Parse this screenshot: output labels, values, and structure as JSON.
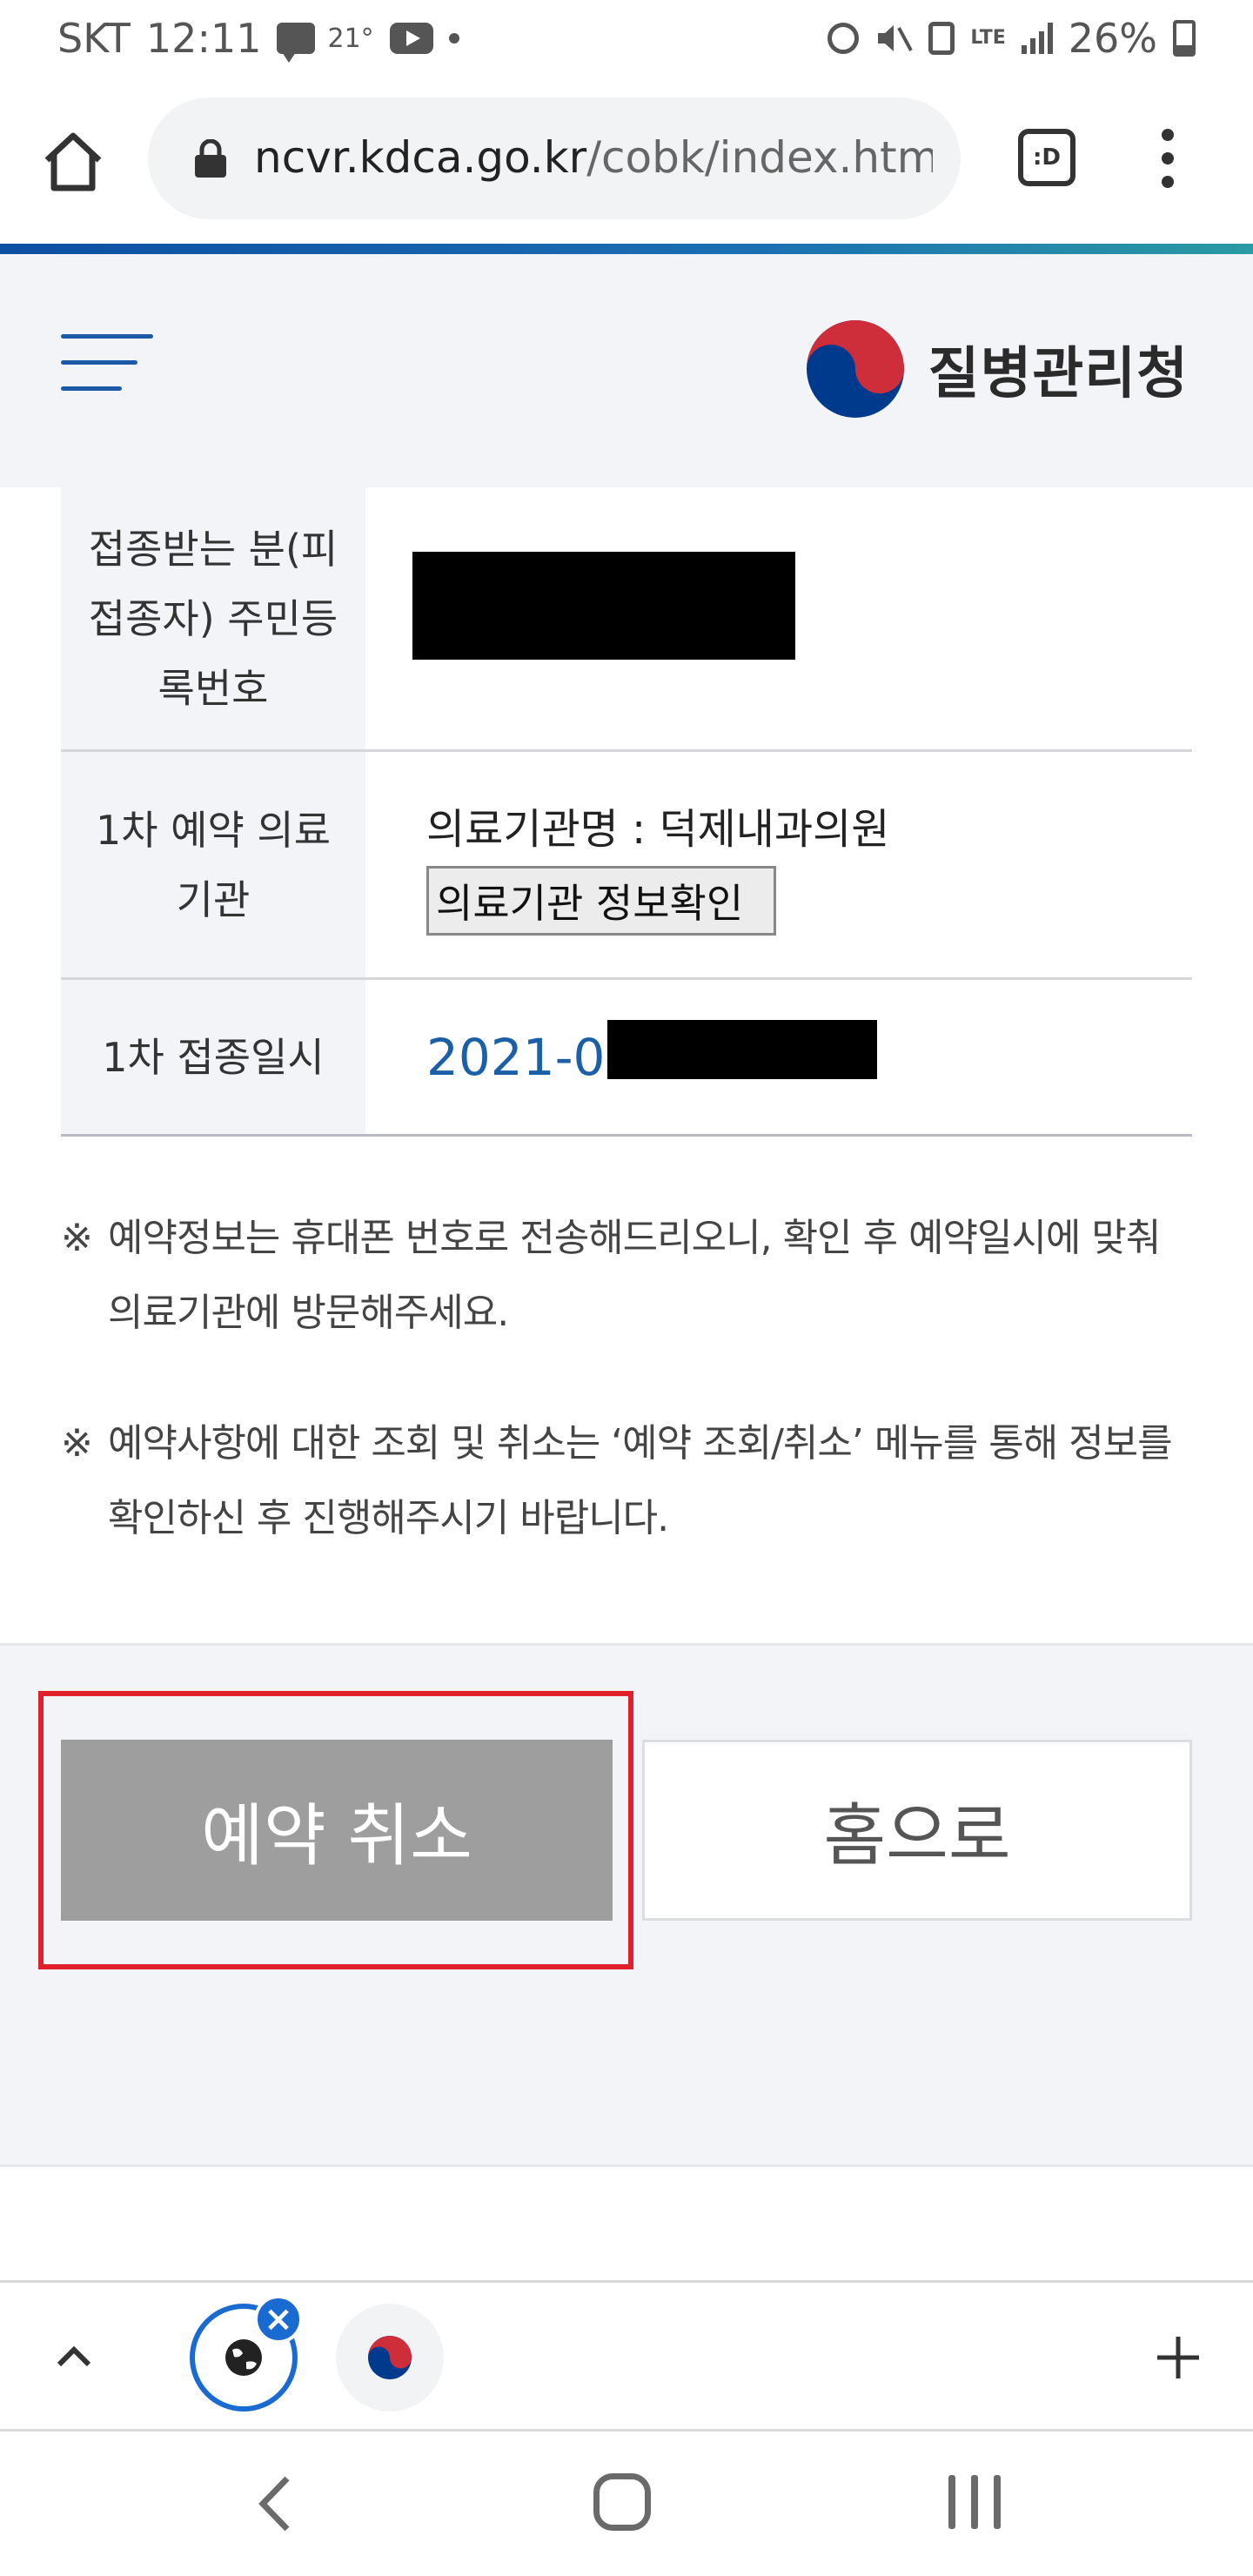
{
  "status_bar": {
    "carrier": "SKT",
    "time": "12:11",
    "temperature": "21°",
    "network": "LTE",
    "battery": "26%"
  },
  "browser": {
    "url_domain": "ncvr.kdca.go.kr",
    "url_path": "/cobk/index.htm",
    "tab_button_label": ":D"
  },
  "header": {
    "logo_text": "질병관리청"
  },
  "reservation_table": {
    "rows": [
      {
        "label": "접종받는 분(피접종자) 주민등록번호",
        "value": ""
      },
      {
        "label": "1차 예약 의료기관",
        "value": "의료기관명 : 덕제내과의원",
        "button": "의료기관 정보확인"
      },
      {
        "label": "1차 접종일시",
        "value": "2021-06"
      }
    ]
  },
  "notes": [
    "예약정보는 휴대폰 번호로 전송해드리오니, 확인 후 예약일시에 맞춰 의료기관에 방문해주세요.",
    "예약사항에 대한 조회 및 취소는 ‘예약 조회/취소’ 메뉴를 통해 정보를 확인하신 후 진행해주시기 바랍니다."
  ],
  "note_mark": "※",
  "actions": {
    "cancel_label": "예약 취소",
    "home_label": "홈으로"
  },
  "colors": {
    "accent_blue": "#1a5fa8",
    "highlight_red": "#e0202a",
    "cancel_gray": "#9e9e9e"
  }
}
